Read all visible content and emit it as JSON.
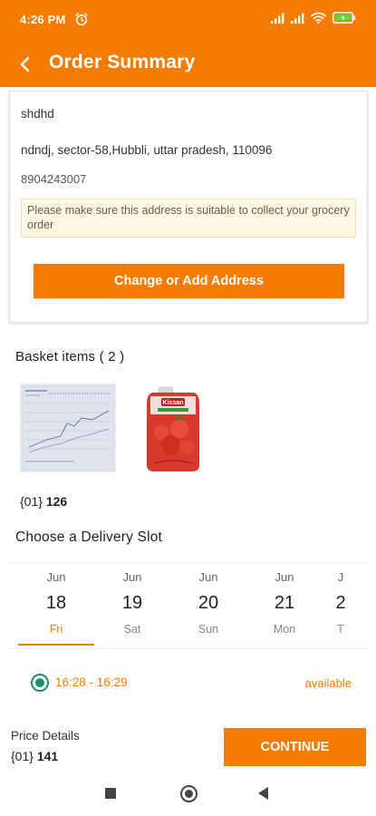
{
  "status_bar": {
    "time": "4:26 PM",
    "icons": [
      "alarm-icon",
      "signal-icon",
      "signal-icon",
      "wifi-icon",
      "battery-charging-icon"
    ]
  },
  "app_bar": {
    "title": "Order Summary",
    "back_icon": "arrow-left-icon"
  },
  "address": {
    "name": "shdhd",
    "line": "ndndj, sector-58,Hubbli, uttar pradesh, 110096",
    "phone": "8904243007",
    "note": "Please make sure this address is suitable to collect your grocery order",
    "change_button": "Change or Add Address"
  },
  "basket": {
    "title": "Basket items ( 2 )",
    "items": [
      {
        "image": "document-thumbnail"
      },
      {
        "image": "kissan-ketchup-pouch",
        "logo_text": "Kissan"
      }
    ],
    "total_prefix": "{01}",
    "total_value": "126"
  },
  "delivery": {
    "title": "Choose a Delivery Slot",
    "dates": [
      {
        "month": "Jun",
        "day": "18",
        "weekday": "Fri",
        "selected": true
      },
      {
        "month": "Jun",
        "day": "19",
        "weekday": "Sat",
        "selected": false
      },
      {
        "month": "Jun",
        "day": "20",
        "weekday": "Sun",
        "selected": false
      },
      {
        "month": "Jun",
        "day": "21",
        "weekday": "Mon",
        "selected": false
      },
      {
        "month": "J",
        "day": "2",
        "weekday": "T",
        "selected": false
      }
    ],
    "slot": {
      "time": "16:28 - 16:29",
      "status": "available",
      "selected": true
    }
  },
  "price": {
    "label": "Price Details",
    "prefix": "{01}",
    "value": "141"
  },
  "continue_button": "CONTINUE",
  "colors": {
    "primary": "#f57c00",
    "radio": "#1f8e6e",
    "note_bg": "#fdf7e5"
  },
  "nav_bar": {
    "icons": [
      "recent-apps-icon",
      "home-icon",
      "back-triangle-icon"
    ]
  }
}
